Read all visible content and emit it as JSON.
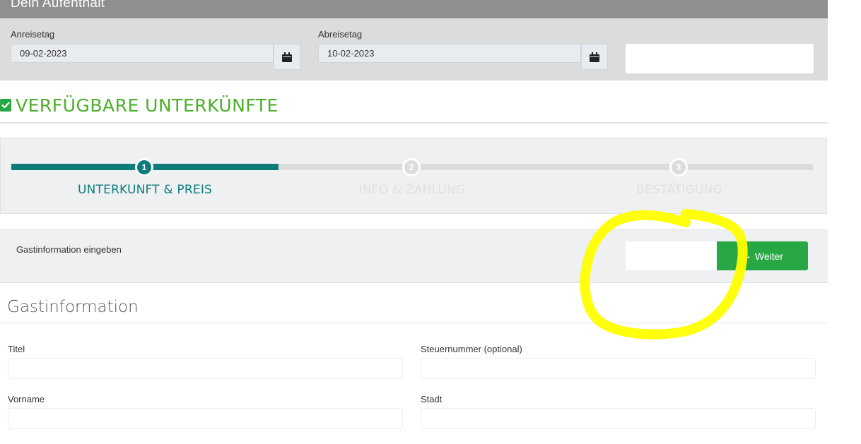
{
  "stay": {
    "title": "Dein Aufenthalt",
    "arrival_label": "Anreisetag",
    "arrival_value": "09-02-2023",
    "departure_label": "Abreisetag",
    "departure_value": "10-02-2023"
  },
  "section": {
    "title": "VERFÜGBARE UNTERKÜNFTE",
    "accent_color": "#4caf2a"
  },
  "stepper": {
    "progress": 0.333,
    "steps": [
      {
        "number": "1",
        "label": "UNTERKUNFT & PREIS",
        "active": true
      },
      {
        "number": "2",
        "label": "INFO & ZAHLUNG",
        "active": false
      },
      {
        "number": "3",
        "label": "BESTÄTIGUNG",
        "active": false
      }
    ],
    "active_color": "#0e7c7b"
  },
  "guest_bar": {
    "text": "Gastinformation eingeben",
    "next_button": "Weiter",
    "button_color": "#28a745"
  },
  "guest_info": {
    "title": "Gastinformation",
    "fields": [
      {
        "label": "Titel"
      },
      {
        "label": "Steuernummer (optional)"
      },
      {
        "label": "Vorname"
      },
      {
        "label": "Stadt"
      }
    ]
  },
  "annotation": {
    "color": "#ffff00",
    "shape": "hand-drawn circle"
  }
}
